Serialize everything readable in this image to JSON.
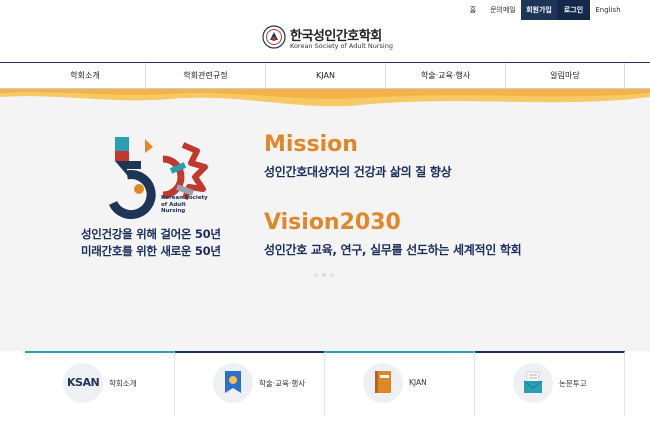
{
  "topbar": {
    "home": "홈",
    "contact": "문의메일",
    "join": "회원가입",
    "login": "로그인",
    "english": "English"
  },
  "logo": {
    "name_ko": "한국성인간호학회",
    "name_en": "Korean Society of Adult Nursing",
    "emblem_icon": "society-emblem-icon"
  },
  "gnb": {
    "items": [
      {
        "label": "학회소개"
      },
      {
        "label": "학회관련규정"
      },
      {
        "label": "KJAN"
      },
      {
        "label": "학술·교육·행사"
      },
      {
        "label": "알림마당"
      }
    ]
  },
  "hero": {
    "badge_text": "Korean Society of Adult Nursing",
    "tagline_line1": "성인건강을 위해 걸어온 50년",
    "tagline_line2": "미래간호를 위한 새로운 50년",
    "mission_title": "Mission",
    "mission_text": "성인간호대상자의 건강과 삶의 질 향상",
    "vision_title": "Vision2030",
    "vision_text": "성인간호 교육, 연구, 실무를 선도하는 세계적인 학회",
    "slide_count": 3,
    "active_slide": 2
  },
  "quick": {
    "items": [
      {
        "label": "학회소개",
        "icon": "ksan-logo-icon",
        "logo_text": "KSAN"
      },
      {
        "label": "학술·교육·행사",
        "icon": "ribbon-badge-icon"
      },
      {
        "label": "KJAN",
        "icon": "journal-book-icon"
      },
      {
        "label": "논문투고",
        "icon": "envelope-icon"
      }
    ]
  },
  "colors": {
    "navy": "#1d3557",
    "accent_orange": "#e0872a",
    "text_navy": "#1a2e5a",
    "teal": "#2a9fb3"
  }
}
